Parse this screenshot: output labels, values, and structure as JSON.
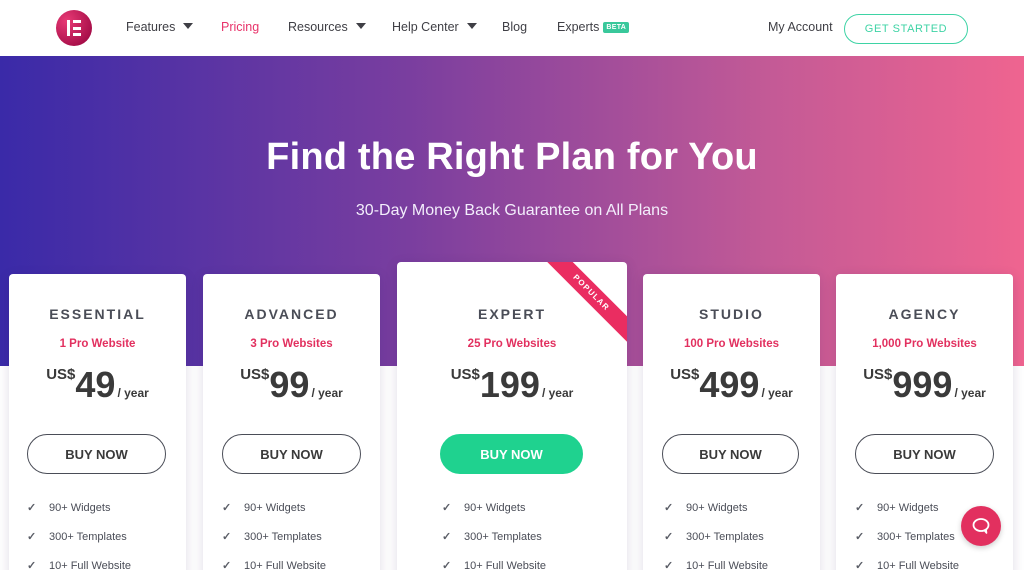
{
  "header": {
    "nav": [
      {
        "label": "Features",
        "dropdown": true
      },
      {
        "label": "Pricing",
        "active": true
      },
      {
        "label": "Resources",
        "dropdown": true
      },
      {
        "label": "Help Center",
        "dropdown": true
      },
      {
        "label": "Blog"
      },
      {
        "label": "Experts",
        "badge": "BETA"
      }
    ],
    "my_account": "My Account",
    "cta": "GET STARTED"
  },
  "hero": {
    "title": "Find the Right Plan for You",
    "subtitle": "30-Day Money Back Guarantee on All Plans"
  },
  "plans": [
    {
      "name": "ESSENTIAL",
      "sites": "1 Pro Website",
      "currency": "US$",
      "price": "49",
      "period": "/ year",
      "button": "BUY NOW",
      "features": [
        "90+ Widgets",
        "300+ Templates",
        "10+ Full Website"
      ]
    },
    {
      "name": "ADVANCED",
      "sites": "3 Pro Websites",
      "currency": "US$",
      "price": "99",
      "period": "/ year",
      "button": "BUY NOW",
      "features": [
        "90+ Widgets",
        "300+ Templates",
        "10+ Full Website"
      ]
    },
    {
      "name": "EXPERT",
      "sites": "25 Pro Websites",
      "currency": "US$",
      "price": "199",
      "period": "/ year",
      "button": "BUY NOW",
      "ribbon": "POPULAR",
      "features": [
        "90+ Widgets",
        "300+ Templates",
        "10+ Full Website"
      ]
    },
    {
      "name": "STUDIO",
      "sites": "100 Pro Websites",
      "currency": "US$",
      "price": "499",
      "period": "/ year",
      "button": "BUY NOW",
      "features": [
        "90+ Widgets",
        "300+ Templates",
        "10+ Full Website"
      ]
    },
    {
      "name": "AGENCY",
      "sites": "1,000 Pro Websites",
      "currency": "US$",
      "price": "999",
      "period": "/ year",
      "button": "BUY NOW",
      "features": [
        "90+ Widgets",
        "300+ Templates",
        "10+ Full Website"
      ]
    }
  ],
  "icons": {
    "logo": "elementor-logo-icon",
    "check": "check-icon",
    "caret": "caret-down-icon",
    "chat": "chat-bubble-icon"
  },
  "colors": {
    "accent_pink": "#e2305f",
    "cta_green": "#1fd28f",
    "outline_green": "#3ed3a5",
    "gradient_start": "#3a2aa8",
    "gradient_end": "#ef6490"
  }
}
